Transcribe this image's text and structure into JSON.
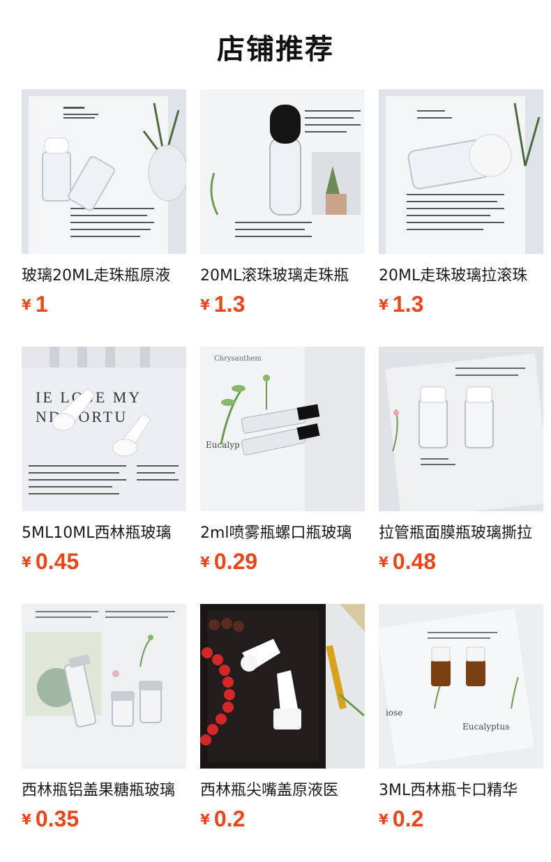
{
  "header": {
    "title": "店铺推荐"
  },
  "currency_symbol": "¥",
  "products": [
    {
      "name": "玻璃20ML走珠瓶原液",
      "price": "1"
    },
    {
      "name": "20ML滚珠玻璃走珠瓶",
      "price": "1.3"
    },
    {
      "name": "20ML走珠玻璃拉滚珠",
      "price": "1.3"
    },
    {
      "name": "5ML10ML西林瓶玻璃",
      "price": "0.45"
    },
    {
      "name": "2ml喷雾瓶螺口瓶玻璃",
      "price": "0.29"
    },
    {
      "name": "拉管瓶面膜瓶玻璃撕拉",
      "price": "0.48"
    },
    {
      "name": "西林瓶铝盖果糖瓶玻璃",
      "price": "0.35"
    },
    {
      "name": "西林瓶尖嘴盖原液医",
      "price": "0.2"
    },
    {
      "name": "3ML西林瓶卡口精华",
      "price": "0.2"
    }
  ],
  "colors": {
    "price": "#e8471b",
    "text": "#1a1a1a"
  }
}
